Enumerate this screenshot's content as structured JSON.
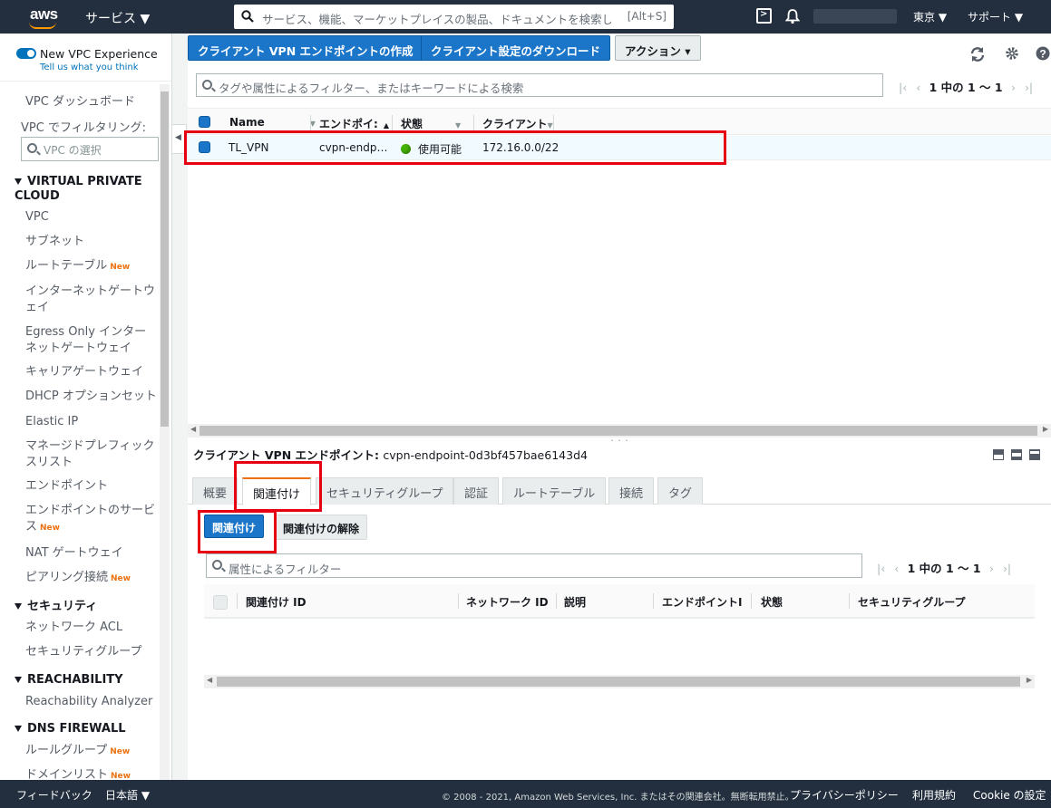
{
  "topnav": {
    "logo": "aws",
    "services": "サービス ▼",
    "search_placeholder": "サービス、機能、マーケットプレイスの製品、ドキュメントを検索し",
    "search_shortcut": "[Alt+S]",
    "region": "東京 ▼",
    "support": "サポート ▼"
  },
  "sidebar": {
    "toggle_label": "New VPC Experience",
    "feedback_link": "Tell us what you think",
    "dashboard": "VPC ダッシュボード",
    "filter_label": "VPC でフィルタリング:",
    "filter_placeholder": "VPC の選択",
    "section_vpc": "VIRTUAL PRIVATE CLOUD",
    "items_vpc": [
      "VPC",
      "サブネット",
      "ルートテーブル",
      "インターネットゲートウェイ",
      "Egress Only インターネットゲートウェイ",
      "キャリアゲートウェイ",
      "DHCP オプションセット",
      "Elastic IP",
      "マネージドプレフィックスリスト",
      "エンドポイント",
      "エンドポイントのサービス",
      "NAT ゲートウェイ",
      "ピアリング接続"
    ],
    "new_badge": "New",
    "section_security": "セキュリティ",
    "items_security": [
      "ネットワーク ACL",
      "セキュリティグループ"
    ],
    "section_reachability": "REACHABILITY",
    "items_reachability": [
      "Reachability Analyzer"
    ],
    "section_dns": "DNS FIREWALL",
    "items_dns": [
      "ルールグループ",
      "ドメインリスト"
    ]
  },
  "toolbar": {
    "create_button": "クライアント VPN エンドポイントの作成",
    "download_button": "クライアント設定のダウンロード",
    "actions_button": "アクション ▾",
    "refresh_icon": "refresh-icon",
    "settings_icon": "gear-icon",
    "help_icon": "help-icon"
  },
  "list": {
    "filter_placeholder": "タグや属性によるフィルター、またはキーワードによる検索",
    "pager_text": "1 中の 1 〜 1",
    "columns": [
      "Name",
      "エンドポイ:",
      "状態",
      "クライアント"
    ],
    "rows": [
      {
        "name": "TL_VPN",
        "endpoint": "cvpn-endp…",
        "status": "使用可能",
        "client": "172.16.0.0/22"
      }
    ]
  },
  "detail": {
    "title_label": "クライアント VPN エンドポイント:",
    "title_value": "cvpn-endpoint-0d3bf457bae6143d4",
    "tabs": [
      "概要",
      "関連付け",
      "セキュリティグループ",
      "認証",
      "ルートテーブル",
      "接続",
      "タグ"
    ],
    "active_tab": "関連付け",
    "associate_button": "関連付け",
    "disassociate_button": "関連付けの解除",
    "filter_placeholder": "属性によるフィルター",
    "pager_text": "1 中の 1 〜 1",
    "columns": [
      "関連付け ID",
      "ネットワーク ID",
      "説明",
      "エンドポイントI",
      "状態",
      "セキュリティグループ"
    ]
  },
  "footer": {
    "feedback": "フィードバック",
    "language": "日本語 ▼",
    "copyright": "© 2008 - 2021, Amazon Web Services, Inc. またはその関連会社。無断転用禁止。",
    "privacy": "プライバシーポリシー",
    "terms": "利用規約",
    "cookie": "Cookie の設定"
  },
  "colors": {
    "nav_bg": "#232f3e",
    "primary": "#1b76c9",
    "highlight": "#e60012",
    "status_ok": "#45b400"
  }
}
